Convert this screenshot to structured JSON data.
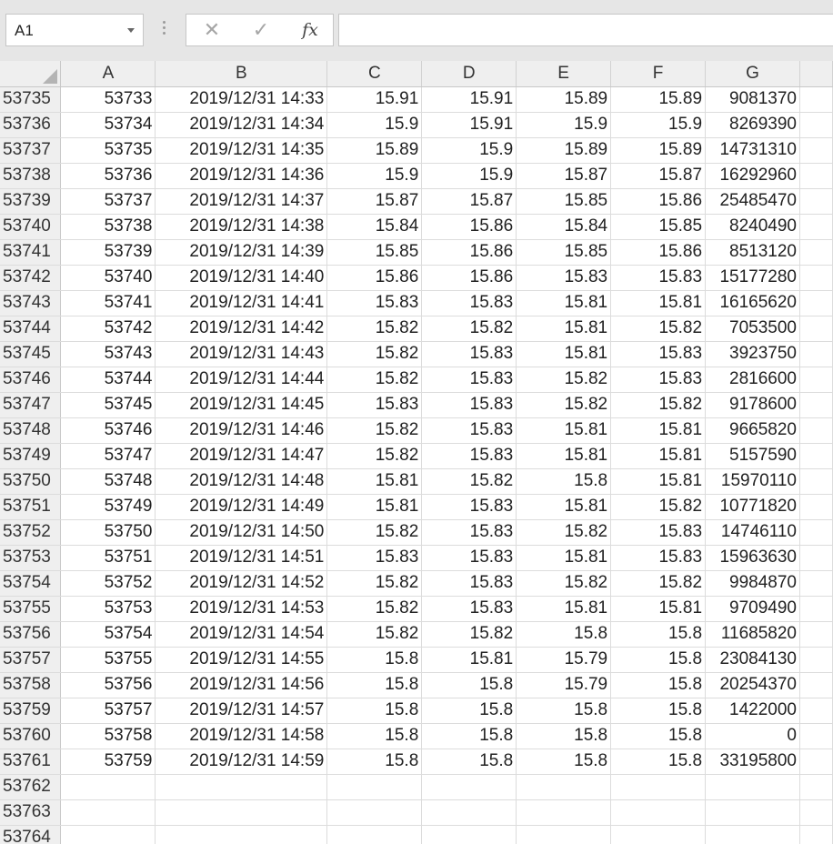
{
  "name_box": {
    "value": "A1"
  },
  "formula_bar": {
    "cancel_glyph": "✕",
    "enter_glyph": "✓",
    "fx_label": "fx",
    "content": ""
  },
  "columns": [
    "A",
    "B",
    "C",
    "D",
    "E",
    "F",
    "G"
  ],
  "rows": [
    {
      "num": "53735",
      "cells": [
        "53733",
        "2019/12/31 14:33",
        "15.91",
        "15.91",
        "15.89",
        "15.89",
        "9081370"
      ]
    },
    {
      "num": "53736",
      "cells": [
        "53734",
        "2019/12/31 14:34",
        "15.9",
        "15.91",
        "15.9",
        "15.9",
        "8269390"
      ]
    },
    {
      "num": "53737",
      "cells": [
        "53735",
        "2019/12/31 14:35",
        "15.89",
        "15.9",
        "15.89",
        "15.89",
        "14731310"
      ]
    },
    {
      "num": "53738",
      "cells": [
        "53736",
        "2019/12/31 14:36",
        "15.9",
        "15.9",
        "15.87",
        "15.87",
        "16292960"
      ]
    },
    {
      "num": "53739",
      "cells": [
        "53737",
        "2019/12/31 14:37",
        "15.87",
        "15.87",
        "15.85",
        "15.86",
        "25485470"
      ]
    },
    {
      "num": "53740",
      "cells": [
        "53738",
        "2019/12/31 14:38",
        "15.84",
        "15.86",
        "15.84",
        "15.85",
        "8240490"
      ]
    },
    {
      "num": "53741",
      "cells": [
        "53739",
        "2019/12/31 14:39",
        "15.85",
        "15.86",
        "15.85",
        "15.86",
        "8513120"
      ]
    },
    {
      "num": "53742",
      "cells": [
        "53740",
        "2019/12/31 14:40",
        "15.86",
        "15.86",
        "15.83",
        "15.83",
        "15177280"
      ]
    },
    {
      "num": "53743",
      "cells": [
        "53741",
        "2019/12/31 14:41",
        "15.83",
        "15.83",
        "15.81",
        "15.81",
        "16165620"
      ]
    },
    {
      "num": "53744",
      "cells": [
        "53742",
        "2019/12/31 14:42",
        "15.82",
        "15.82",
        "15.81",
        "15.82",
        "7053500"
      ]
    },
    {
      "num": "53745",
      "cells": [
        "53743",
        "2019/12/31 14:43",
        "15.82",
        "15.83",
        "15.81",
        "15.83",
        "3923750"
      ]
    },
    {
      "num": "53746",
      "cells": [
        "53744",
        "2019/12/31 14:44",
        "15.82",
        "15.83",
        "15.82",
        "15.83",
        "2816600"
      ]
    },
    {
      "num": "53747",
      "cells": [
        "53745",
        "2019/12/31 14:45",
        "15.83",
        "15.83",
        "15.82",
        "15.82",
        "9178600"
      ]
    },
    {
      "num": "53748",
      "cells": [
        "53746",
        "2019/12/31 14:46",
        "15.82",
        "15.83",
        "15.81",
        "15.81",
        "9665820"
      ]
    },
    {
      "num": "53749",
      "cells": [
        "53747",
        "2019/12/31 14:47",
        "15.82",
        "15.83",
        "15.81",
        "15.81",
        "5157590"
      ]
    },
    {
      "num": "53750",
      "cells": [
        "53748",
        "2019/12/31 14:48",
        "15.81",
        "15.82",
        "15.8",
        "15.81",
        "15970110"
      ]
    },
    {
      "num": "53751",
      "cells": [
        "53749",
        "2019/12/31 14:49",
        "15.81",
        "15.83",
        "15.81",
        "15.82",
        "10771820"
      ]
    },
    {
      "num": "53752",
      "cells": [
        "53750",
        "2019/12/31 14:50",
        "15.82",
        "15.83",
        "15.82",
        "15.83",
        "14746110"
      ]
    },
    {
      "num": "53753",
      "cells": [
        "53751",
        "2019/12/31 14:51",
        "15.83",
        "15.83",
        "15.81",
        "15.83",
        "15963630"
      ]
    },
    {
      "num": "53754",
      "cells": [
        "53752",
        "2019/12/31 14:52",
        "15.82",
        "15.83",
        "15.82",
        "15.82",
        "9984870"
      ]
    },
    {
      "num": "53755",
      "cells": [
        "53753",
        "2019/12/31 14:53",
        "15.82",
        "15.83",
        "15.81",
        "15.81",
        "9709490"
      ]
    },
    {
      "num": "53756",
      "cells": [
        "53754",
        "2019/12/31 14:54",
        "15.82",
        "15.82",
        "15.8",
        "15.8",
        "11685820"
      ]
    },
    {
      "num": "53757",
      "cells": [
        "53755",
        "2019/12/31 14:55",
        "15.8",
        "15.81",
        "15.79",
        "15.8",
        "23084130"
      ]
    },
    {
      "num": "53758",
      "cells": [
        "53756",
        "2019/12/31 14:56",
        "15.8",
        "15.8",
        "15.79",
        "15.8",
        "20254370"
      ]
    },
    {
      "num": "53759",
      "cells": [
        "53757",
        "2019/12/31 14:57",
        "15.8",
        "15.8",
        "15.8",
        "15.8",
        "1422000"
      ]
    },
    {
      "num": "53760",
      "cells": [
        "53758",
        "2019/12/31 14:58",
        "15.8",
        "15.8",
        "15.8",
        "15.8",
        "0"
      ]
    },
    {
      "num": "53761",
      "cells": [
        "53759",
        "2019/12/31 14:59",
        "15.8",
        "15.8",
        "15.8",
        "15.8",
        "33195800"
      ]
    },
    {
      "num": "53762",
      "cells": [
        "",
        "",
        "",
        "",
        "",
        "",
        ""
      ]
    },
    {
      "num": "53763",
      "cells": [
        "",
        "",
        "",
        "",
        "",
        "",
        ""
      ]
    },
    {
      "num": "53764",
      "cells": [
        "",
        "",
        "",
        "",
        "",
        "",
        ""
      ]
    }
  ]
}
